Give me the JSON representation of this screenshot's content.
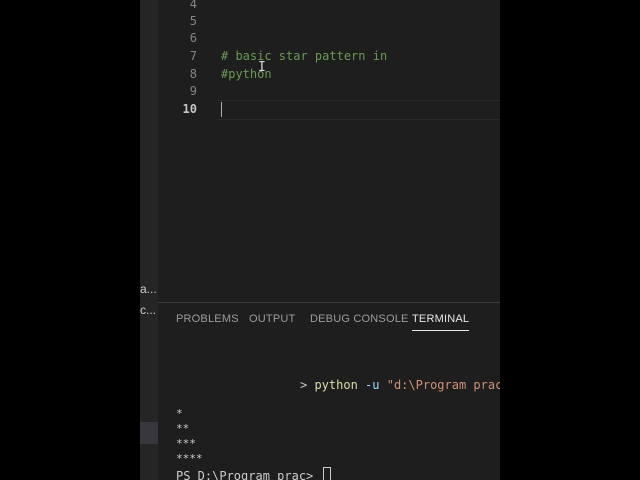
{
  "sidebar": {
    "items": [
      "a...",
      "c..."
    ]
  },
  "editor": {
    "line_numbers": [
      "4",
      "5",
      "6",
      "7",
      "8",
      "9",
      "10"
    ],
    "current_line": "10",
    "lines": [
      "",
      "",
      "",
      "# basic star pattern in",
      "#python",
      "",
      ""
    ]
  },
  "panel": {
    "tabs": [
      "PROBLEMS",
      "OUTPUT",
      "DEBUG CONSOLE",
      "TERMINAL"
    ],
    "active_tab": "TERMINAL"
  },
  "terminal": {
    "command": {
      "prompt_char": "> ",
      "executable": "python",
      "flag": " -u ",
      "argument": "\"d:\\Program prac\\"
    },
    "output": [
      "*",
      "**",
      "***",
      "****"
    ],
    "prompt": "PS D:\\Program prac> "
  },
  "colors": {
    "editor_bg": "#1e1e1e",
    "comment": "#6a9955",
    "active_tab_underline": "#e7e7e7"
  }
}
